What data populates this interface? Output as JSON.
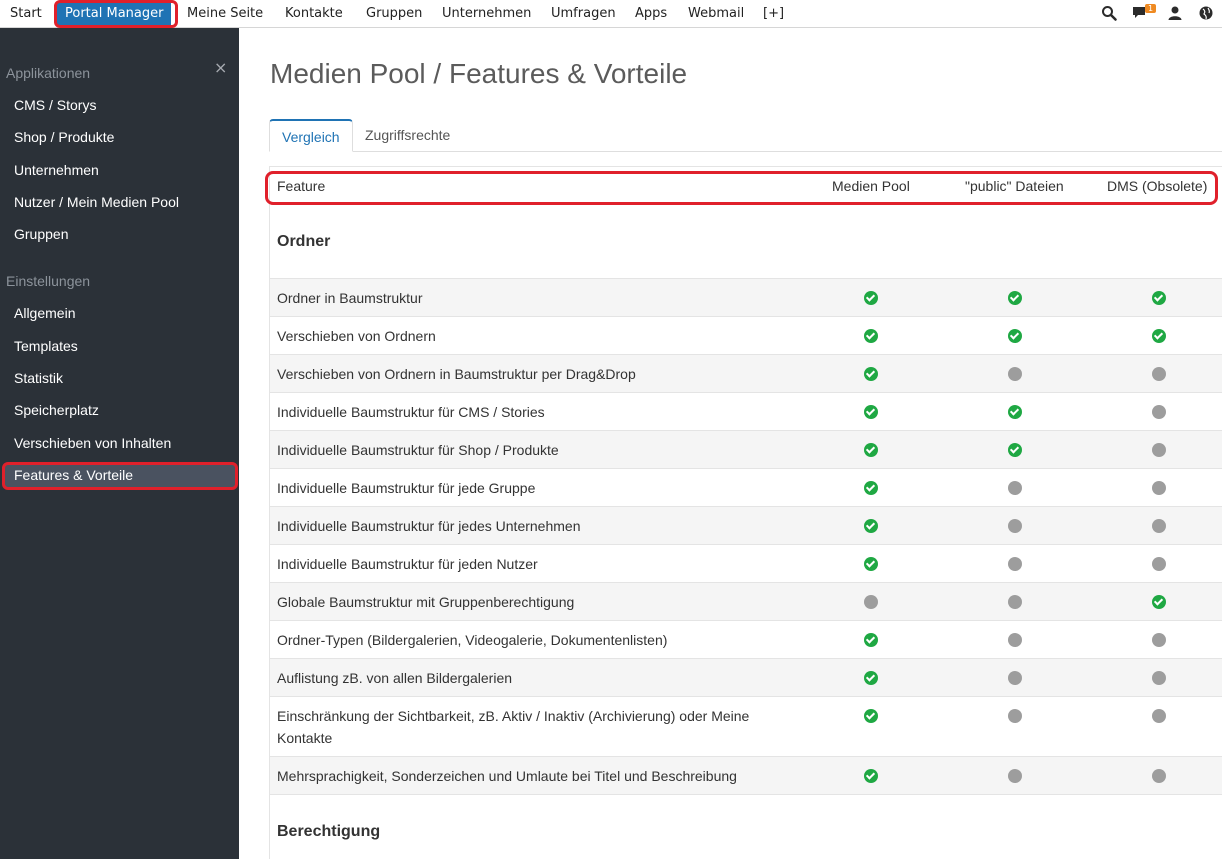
{
  "nav": {
    "items": [
      "Start",
      "Portal Manager",
      "Meine Seite",
      "Kontakte",
      "Gruppen",
      "Unternehmen",
      "Umfragen",
      "Apps",
      "Webmail",
      "[+]"
    ],
    "active_index": 1,
    "notification_count": "1",
    "icons": [
      "search-icon",
      "chat-icon",
      "user-icon",
      "globe-icon"
    ]
  },
  "sidebar": {
    "close_glyph": "×",
    "sections": [
      {
        "heading": "Applikationen",
        "items": [
          "CMS / Storys",
          "Shop / Produkte",
          "Unternehmen",
          "Nutzer / Mein Medien Pool",
          "Gruppen"
        ]
      },
      {
        "heading": "Einstellungen",
        "items": [
          "Allgemein",
          "Templates",
          "Statistik",
          "Speicherplatz",
          "Verschieben von Inhalten",
          "Features & Vorteile"
        ]
      }
    ],
    "active_item": "Features & Vorteile"
  },
  "main": {
    "title": "Medien Pool / Features & Vorteile",
    "tabs": [
      {
        "label": "Vergleich",
        "active": true
      },
      {
        "label": "Zugriffsrechte",
        "active": false
      }
    ],
    "table": {
      "headers": [
        "Feature",
        "Medien Pool",
        "\"public\" Dateien",
        "DMS (Obsolete)"
      ],
      "sections": [
        {
          "title": "Ordner",
          "rows": [
            {
              "label": "Ordner in Baumstruktur",
              "values": [
                true,
                true,
                true
              ]
            },
            {
              "label": "Verschieben von Ordnern",
              "values": [
                true,
                true,
                true
              ]
            },
            {
              "label": "Verschieben von Ordnern in Baumstruktur per Drag&Drop",
              "values": [
                true,
                false,
                false
              ]
            },
            {
              "label": "Individuelle Baumstruktur für CMS / Stories",
              "values": [
                true,
                true,
                false
              ]
            },
            {
              "label": "Individuelle Baumstruktur für Shop / Produkte",
              "values": [
                true,
                true,
                false
              ]
            },
            {
              "label": "Individuelle Baumstruktur für jede Gruppe",
              "values": [
                true,
                false,
                false
              ]
            },
            {
              "label": "Individuelle Baumstruktur für jedes Unternehmen",
              "values": [
                true,
                false,
                false
              ]
            },
            {
              "label": "Individuelle Baumstruktur für jeden Nutzer",
              "values": [
                true,
                false,
                false
              ]
            },
            {
              "label": "Globale Baumstruktur mit Gruppenberechtigung",
              "values": [
                false,
                false,
                true
              ]
            },
            {
              "label": "Ordner-Typen (Bildergalerien, Videogalerie, Dokumentenlisten)",
              "values": [
                true,
                false,
                false
              ]
            },
            {
              "label": "Auflistung zB. von allen Bildergalerien",
              "values": [
                true,
                false,
                false
              ]
            },
            {
              "label": "Einschränkung der Sichtbarkeit, zB. Aktiv / Inaktiv (Archivierung) oder Meine Kontakte",
              "values": [
                true,
                false,
                false
              ]
            },
            {
              "label": "Mehrsprachigkeit, Sonderzeichen und Umlaute bei Titel und Beschreibung",
              "values": [
                true,
                false,
                false
              ]
            }
          ]
        },
        {
          "title": "Berechtigung",
          "rows": []
        }
      ]
    }
  },
  "colors": {
    "accent": "#1f73b4",
    "sidebar_bg": "#2b3138",
    "check_green": "#1fa843",
    "unavailable_gray": "#9d9d9d",
    "highlight_red": "#e0202b"
  }
}
